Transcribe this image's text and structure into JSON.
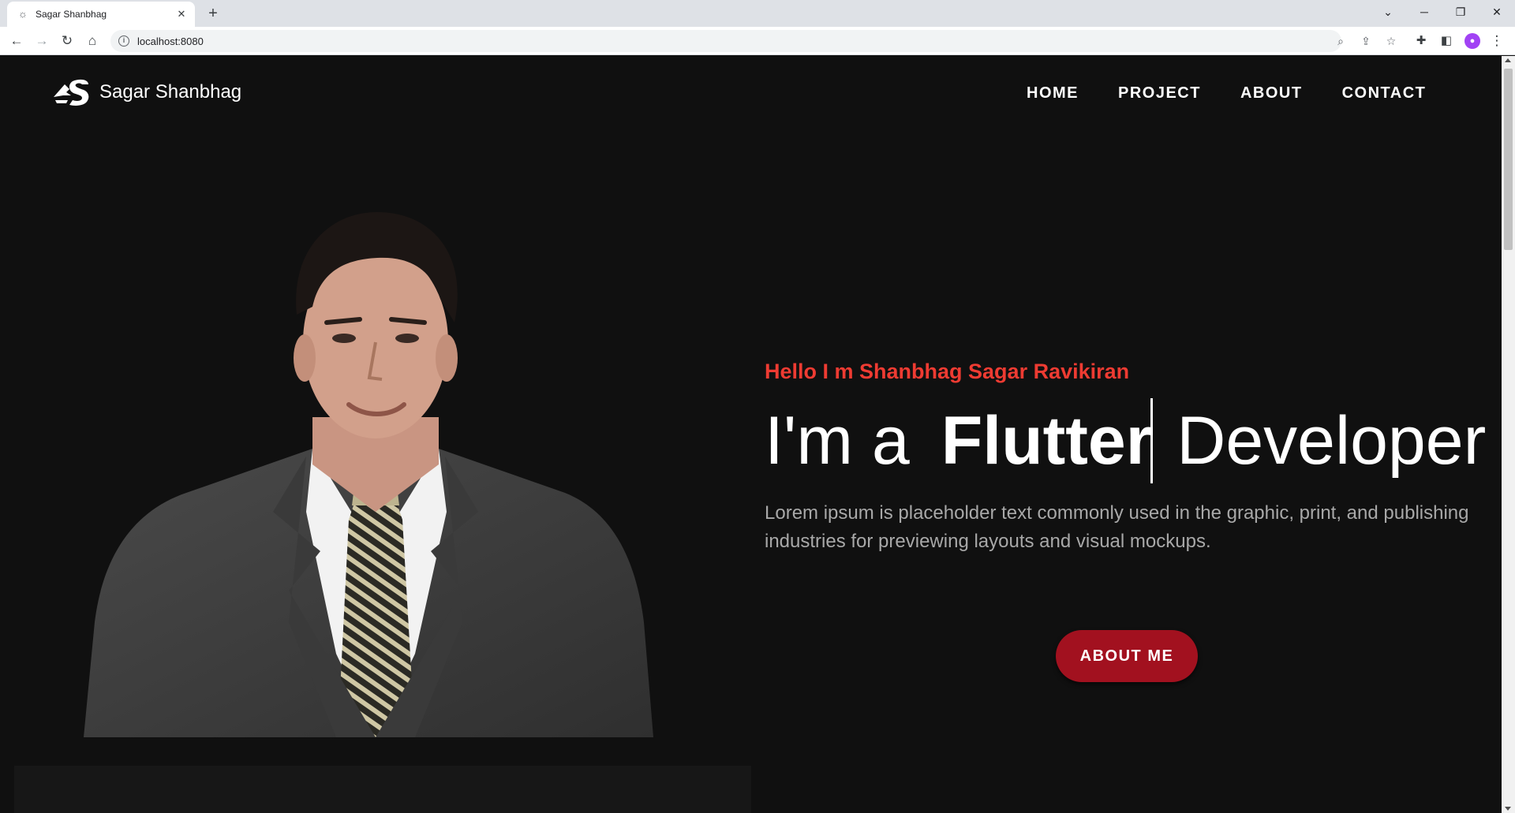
{
  "browser": {
    "tab_title": "Sagar Shanbhag",
    "url": "localhost:8080"
  },
  "site": {
    "brand_name": "Sagar Shanbhag",
    "nav": [
      "HOME",
      "PROJECT",
      "ABOUT",
      "CONTACT"
    ]
  },
  "hero": {
    "greeting": "Hello I m Shanbhag Sagar Ravikiran",
    "headline_prefix": "I'm a",
    "headline_typed": "Flutter",
    "headline_suffix": "Developer",
    "description": "Lorem ipsum is placeholder text commonly used in the graphic, print, and publishing industries for previewing layouts and visual mockups.",
    "button_label": "ABOUT ME"
  },
  "colors": {
    "background": "#101010",
    "accent_red": "#ee3b32",
    "button_red": "#a2111f",
    "muted_text": "#a8a8a8"
  }
}
